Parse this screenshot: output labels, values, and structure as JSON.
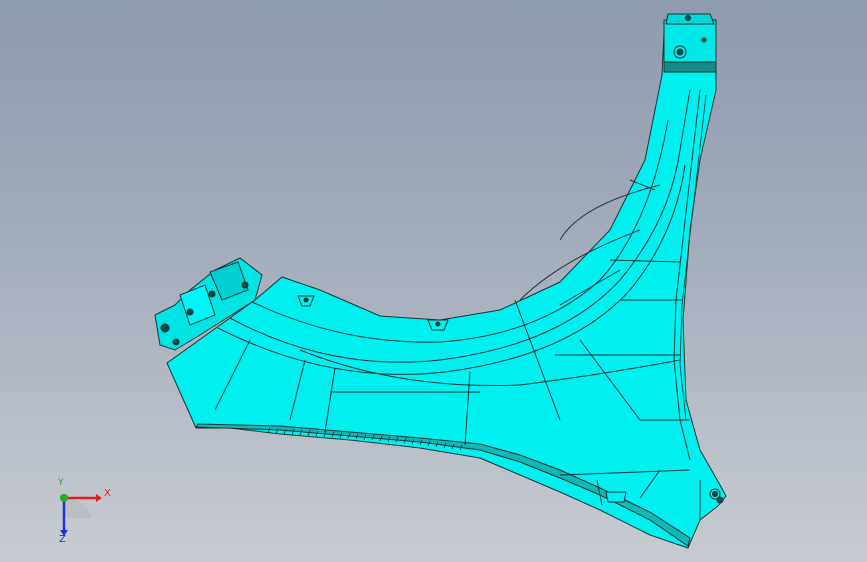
{
  "viewport": {
    "background_top": "#8e9aae",
    "background_bottom": "#c8ccd2",
    "model_color": "#00f2f2",
    "edge_color": "#1d3a3a"
  },
  "triad": {
    "x_label": "X",
    "y_label": "Y",
    "z_label": "Z",
    "x_color": "#e02020",
    "y_color": "#20b020",
    "z_color": "#2030d0"
  }
}
